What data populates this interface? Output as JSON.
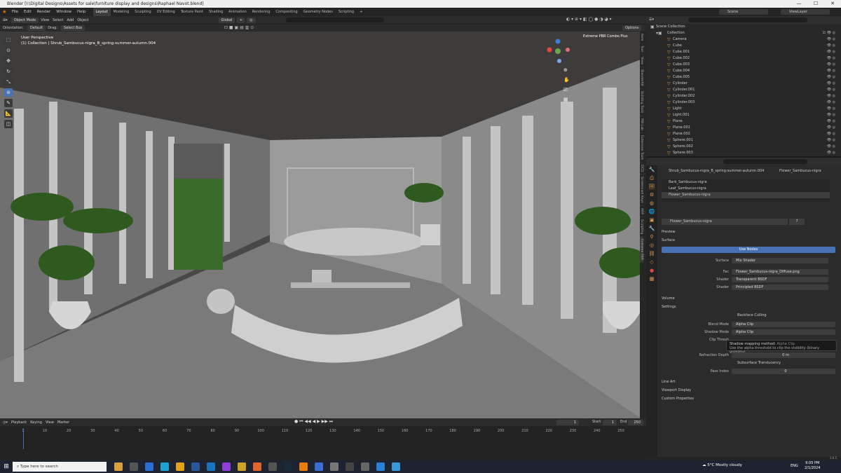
{
  "window": {
    "title": "Blender [I:\\Digital Designs\\Assets for sale\\furniture display and designs\\Raphael Navot.blend]",
    "min": "—",
    "max": "☐",
    "close": "✕"
  },
  "menu": [
    "File",
    "Edit",
    "Render",
    "Window",
    "Help"
  ],
  "workspaces": [
    "Layout",
    "Modeling",
    "Sculpting",
    "UV Editing",
    "Texture Paint",
    "Shading",
    "Animation",
    "Rendering",
    "Compositing",
    "Geometry Nodes",
    "Scripting",
    "+"
  ],
  "scene": {
    "label": "Scene",
    "viewlayer": "ViewLayer"
  },
  "viewport_header": {
    "mode": "Object Mode",
    "menus": [
      "View",
      "Select",
      "Add",
      "Object"
    ],
    "orientation_label": "Orientation:",
    "orientation": "Default",
    "drag_label": "Drag:",
    "drag": "Select Box",
    "transform": "Global",
    "options": "Options"
  },
  "viewport": {
    "perspective": "User Perspective",
    "collection": "(1) Collection | Shrub_Sambucus-nigra_B_spring-summer-autumn.004",
    "addon": "Extreme PBR Combo Plus"
  },
  "side_tabs": [
    "Item",
    "Tool",
    "View",
    "BlenderKit",
    "Building Tools",
    "MB-Lab",
    "Extension Tools",
    "OCD",
    "Screencast Keys",
    "ARP",
    "Sculpting",
    "Extreme PBR"
  ],
  "outliner": {
    "root": "Scene Collection",
    "collection": "Collection",
    "items": [
      "Camera",
      "Cube",
      "Cube.001",
      "Cube.002",
      "Cube.003",
      "Cube.004",
      "Cube.005",
      "Cylinder",
      "Cylinder.001",
      "Cylinder.002",
      "Cylinder.003",
      "Light",
      "Light.001",
      "Plane",
      "Plane.001",
      "Plane.002",
      "Sphere.001",
      "Sphere.002",
      "Sphere.003"
    ]
  },
  "properties": {
    "breadcrumb_object": "Shrub_Sambucus-nigra_B_spring-summer-autumn.004",
    "breadcrumb_material": "Flower_Sambucus-nigra",
    "slots": [
      "Bark_Sambucus-nigra",
      "Leaf_Sambucus-nigra",
      "Flower_Sambucus-nigra"
    ],
    "material_name": "Flower_Sambucus-nigra",
    "user_count": "7",
    "preview": "Preview",
    "surface": "Surface",
    "use_nodes": "Use Nodes",
    "rows": [
      {
        "label": "Surface",
        "value": "Mix Shader"
      },
      {
        "label": "Fac",
        "value": "Flower_Sambucus-nigra_Diffuse.png"
      },
      {
        "label": "Shader",
        "value": "Transparent BSDF"
      },
      {
        "label": "Shader",
        "value": "Principled BSDF"
      }
    ],
    "volume": "Volume",
    "settings": "Settings",
    "backface": "Backface Culling",
    "blend_mode_label": "Blend Mode",
    "blend_mode": "Alpha Clip",
    "shadow_mode_label": "Shadow Mode",
    "shadow_mode": "Alpha Clip",
    "clip_label": "Clip Thresh",
    "tooltip_title": "Shadow mapping method:",
    "tooltip_value": "Alpha Clip",
    "tooltip_desc": "Use the alpha threshold to clip the visibility (binary visibility)",
    "refraction_label": "Refraction Depth",
    "refraction": "0 m",
    "sss": "Subsurface Translucency",
    "pass_label": "Pass Index",
    "pass": "0",
    "line_art": "Line Art",
    "viewport_display": "Viewport Display",
    "custom_props": "Custom Properties"
  },
  "timeline": {
    "menus": [
      "Playback",
      "Keying",
      "View",
      "Marker"
    ],
    "frame": "1",
    "start_label": "Start",
    "start": "1",
    "end_label": "End",
    "end": "250",
    "ticks": [
      "1",
      "10",
      "20",
      "30",
      "40",
      "50",
      "60",
      "70",
      "80",
      "90",
      "100",
      "110",
      "120",
      "130",
      "140",
      "150",
      "160",
      "170",
      "180",
      "190",
      "200",
      "210",
      "220",
      "230",
      "240",
      "250"
    ]
  },
  "statusbar": {
    "version": "3.6.5"
  },
  "taskbar": {
    "search": "Type here to search",
    "weather": "5°C  Mostly cloudy",
    "lang": "ENG",
    "time": "9:05 PM",
    "date": "2/1/2024"
  },
  "colors": {
    "accent": "#4772b3",
    "orange": "#e39a4c",
    "green": "#5fbf7a"
  }
}
